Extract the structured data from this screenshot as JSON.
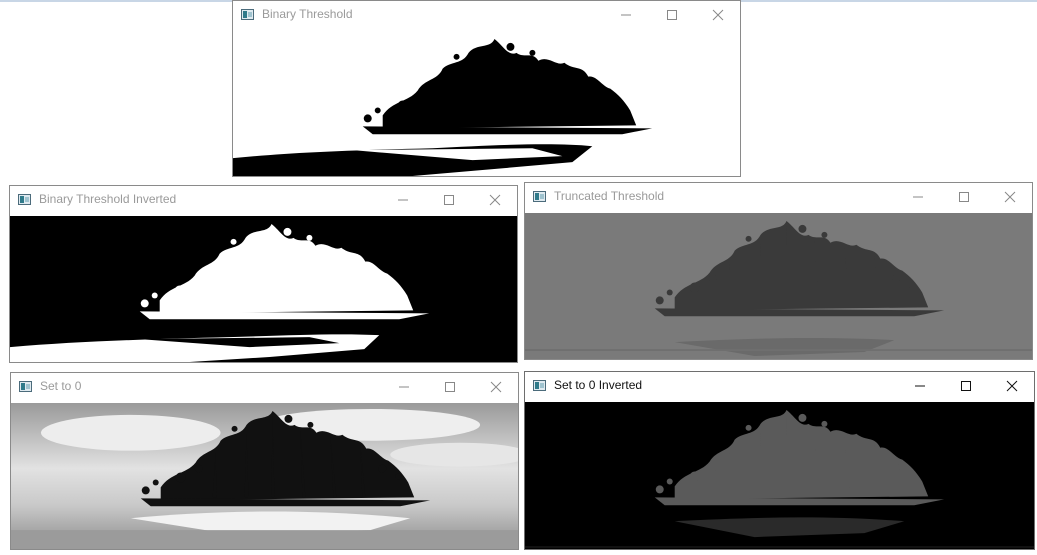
{
  "windows": {
    "binary": {
      "title": "Binary Threshold",
      "icon": "opencv-window-icon",
      "active": false
    },
    "binary_inv": {
      "title": "Binary Threshold Inverted",
      "icon": "opencv-window-icon",
      "active": false
    },
    "trunc": {
      "title": "Truncated Threshold",
      "icon": "opencv-window-icon",
      "active": false
    },
    "tozero": {
      "title": "Set to 0",
      "icon": "opencv-window-icon",
      "active": false
    },
    "tozero_inv": {
      "title": "Set to 0 Inverted",
      "icon": "opencv-window-icon",
      "active": true
    }
  },
  "controls": {
    "minimize": "minimize-icon",
    "maximize": "maximize-icon",
    "close": "close-icon"
  }
}
